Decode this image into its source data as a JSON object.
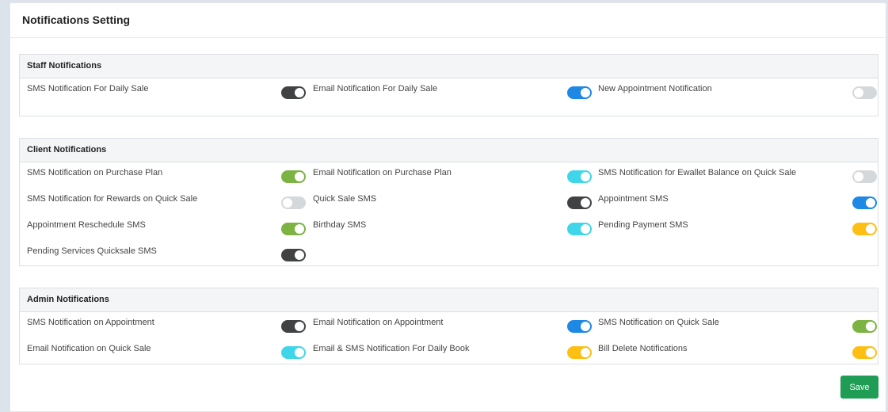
{
  "page": {
    "title": "Notifications Setting"
  },
  "colors": {
    "dark": "#404244",
    "blue": "#1e88e5",
    "green": "#7cb342",
    "cyan": "#3fd6ea",
    "yellow": "#fdbf13",
    "off": "#d5d8db",
    "save": "#1f9d55"
  },
  "sections": {
    "staff": {
      "title": "Staff Notifications",
      "items": [
        {
          "label": "SMS Notification For Daily Sale",
          "on": true,
          "color": "#404244"
        },
        {
          "label": "Email Notification For Daily Sale",
          "on": true,
          "color": "#1e88e5"
        },
        {
          "label": "New Appointment Notification",
          "on": false,
          "color": "#d5d8db"
        }
      ]
    },
    "client": {
      "title": "Client Notifications",
      "items": [
        {
          "label": "SMS Notification on Purchase Plan",
          "on": true,
          "color": "#7cb342"
        },
        {
          "label": "Email Notification on Purchase Plan",
          "on": true,
          "color": "#3fd6ea"
        },
        {
          "label": "SMS Notification for Ewallet Balance on Quick Sale",
          "on": false,
          "color": "#d5d8db"
        },
        {
          "label": "SMS Notification for Rewards on Quick Sale",
          "on": false,
          "color": "#d5d8db"
        },
        {
          "label": "Quick Sale SMS",
          "on": true,
          "color": "#404244"
        },
        {
          "label": "Appointment SMS",
          "on": true,
          "color": "#1e88e5"
        },
        {
          "label": "Appointment Reschedule SMS",
          "on": true,
          "color": "#7cb342"
        },
        {
          "label": "Birthday SMS",
          "on": true,
          "color": "#3fd6ea"
        },
        {
          "label": "Pending Payment SMS",
          "on": true,
          "color": "#fdbf13"
        },
        {
          "label": "Pending Services Quicksale SMS",
          "on": true,
          "color": "#404244"
        }
      ]
    },
    "admin": {
      "title": "Admin Notifications",
      "items": [
        {
          "label": "SMS Notification on Appointment",
          "on": true,
          "color": "#404244"
        },
        {
          "label": "Email Notification on Appointment",
          "on": true,
          "color": "#1e88e5"
        },
        {
          "label": "SMS Notification on Quick Sale",
          "on": true,
          "color": "#7cb342"
        },
        {
          "label": "Email Notification on Quick Sale",
          "on": true,
          "color": "#3fd6ea"
        },
        {
          "label": "Email & SMS Notification For Daily Book",
          "on": true,
          "color": "#fdbf13"
        },
        {
          "label": "Bill Delete Notifications",
          "on": true,
          "color": "#fdbf13"
        }
      ]
    }
  },
  "actions": {
    "save_label": "Save"
  }
}
